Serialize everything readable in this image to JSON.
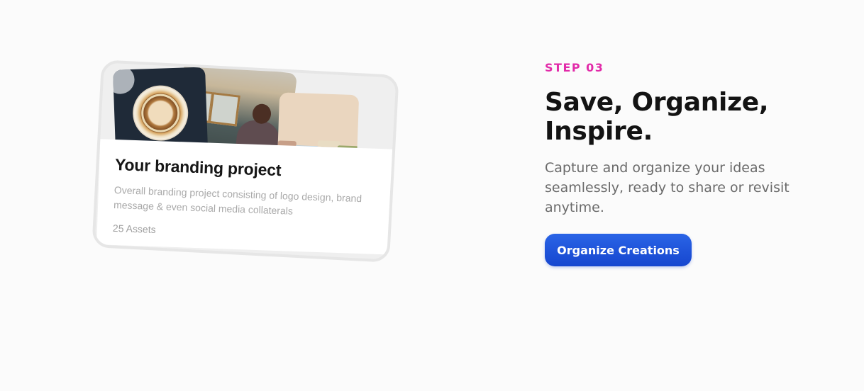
{
  "card": {
    "title": "Your branding project",
    "description": "Overall branding project consisting of logo design, brand message & even social media collaterals",
    "assets": "25 Assets"
  },
  "step": {
    "label": "STEP 03",
    "heading": "Save, Organize, Inspire.",
    "subtext": "Capture and organize your ideas seamlessly, ready to share or revisit anytime.",
    "cta_label": "Organize Creations"
  },
  "colors": {
    "step_accent": "#e22ba9",
    "button": "#1e55db",
    "heading": "#131313",
    "body_text": "#6a6a6a"
  }
}
